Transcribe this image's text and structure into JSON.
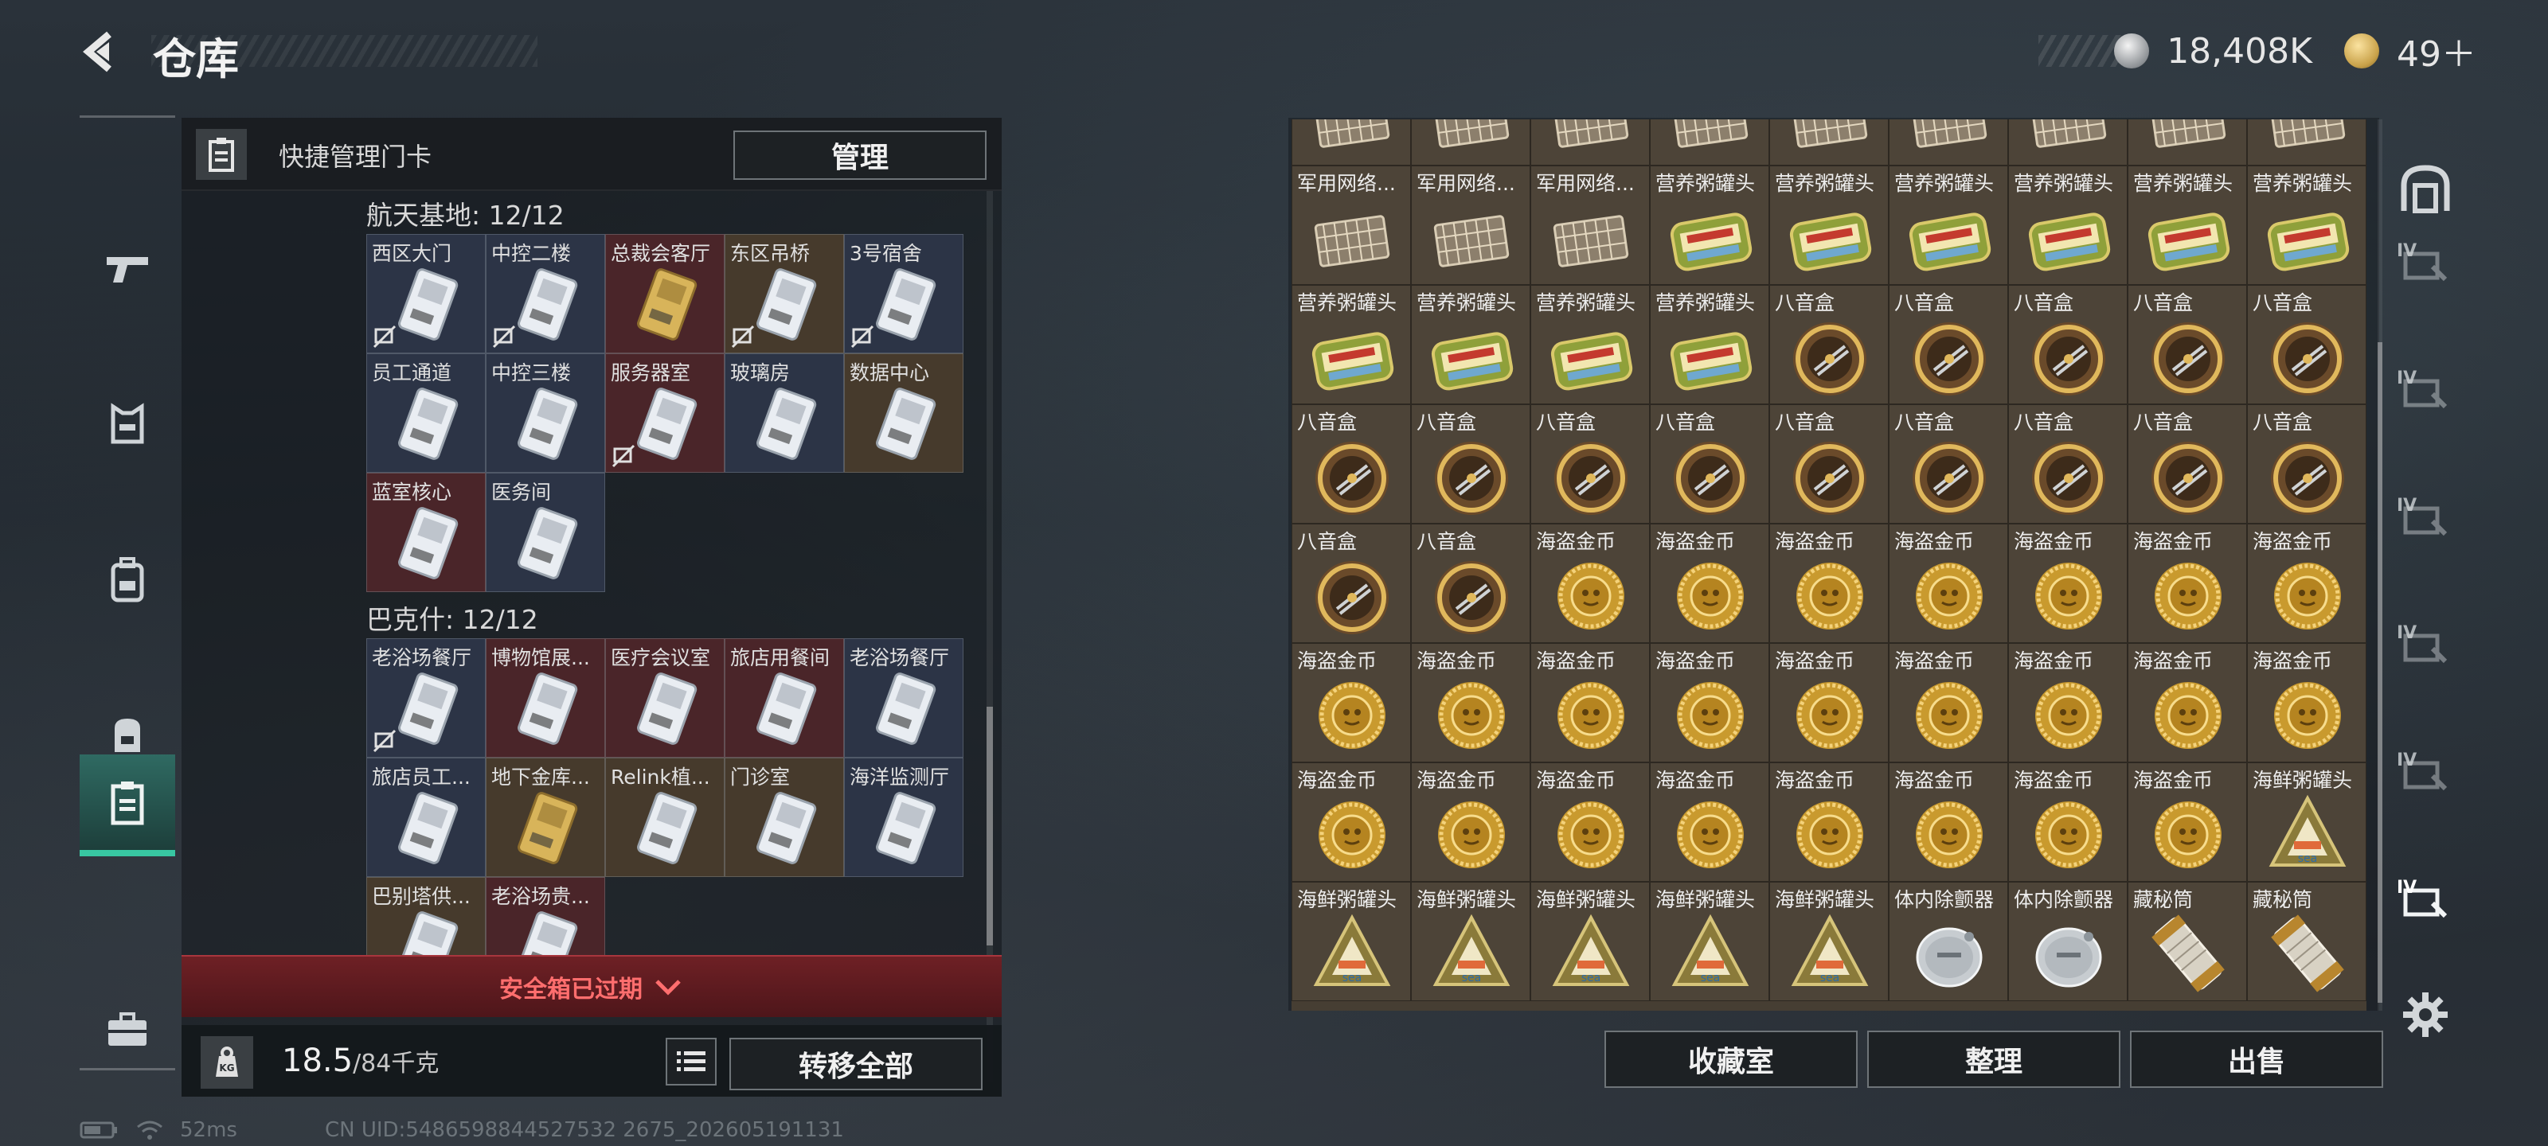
{
  "header": {
    "title": "仓库",
    "currencies": [
      {
        "icon": "silver-coin-icon",
        "value": "18,408K",
        "color": "#c8c8c8"
      },
      {
        "icon": "gold-token-icon",
        "value": "49＋",
        "color": "#c9a24a"
      }
    ]
  },
  "left_nav": {
    "items": [
      {
        "name": "weapon-icon"
      },
      {
        "name": "armor-icon"
      },
      {
        "name": "backpack-icon"
      },
      {
        "name": "bag-icon"
      },
      {
        "name": "keycard-holder-icon",
        "active": true
      },
      {
        "name": "briefcase-icon"
      }
    ]
  },
  "card_panel": {
    "header_title": "快捷管理门卡",
    "manage_label": "管理",
    "sections": [
      {
        "title": "航天基地: 12/12",
        "cards": [
          {
            "label": "西区大门",
            "color": "blue",
            "no_mark": true
          },
          {
            "label": "中控二楼",
            "color": "blue",
            "no_mark": true
          },
          {
            "label": "总裁会客厅",
            "color": "red",
            "gold": true
          },
          {
            "label": "东区吊桥",
            "color": "gold",
            "no_mark": true
          },
          {
            "label": "3号宿舍",
            "color": "blue",
            "no_mark": true
          },
          {
            "label": "员工通道",
            "color": "blue"
          },
          {
            "label": "中控三楼",
            "color": "blue"
          },
          {
            "label": "服务器室",
            "color": "red",
            "no_mark": true
          },
          {
            "label": "玻璃房",
            "color": "blue"
          },
          {
            "label": "数据中心",
            "color": "gold"
          },
          {
            "label": "蓝室核心",
            "color": "red"
          },
          {
            "label": "医务间",
            "color": "blue"
          }
        ]
      },
      {
        "title": "巴克什: 12/12",
        "cards": [
          {
            "label": "老浴场餐厅",
            "color": "blue",
            "no_mark": true
          },
          {
            "label": "博物馆展...",
            "color": "red"
          },
          {
            "label": "医疗会议室",
            "color": "red"
          },
          {
            "label": "旅店用餐间",
            "color": "red"
          },
          {
            "label": "老浴场餐厅",
            "color": "blue"
          },
          {
            "label": "旅店员工...",
            "color": "blue"
          },
          {
            "label": "地下金库...",
            "color": "gold",
            "gold": true
          },
          {
            "label": "Relink植...",
            "color": "gold"
          },
          {
            "label": "门诊室",
            "color": "gold"
          },
          {
            "label": "海洋监测厅",
            "color": "blue"
          },
          {
            "label": "巴别塔供...",
            "color": "gold"
          },
          {
            "label": "老浴场贵...",
            "color": "red"
          }
        ]
      }
    ],
    "expired_label": "安全箱已过期",
    "weight_current": "18.5",
    "weight_max": "/84千克",
    "transfer_label": "转移全部"
  },
  "inventory": {
    "rows": [
      [
        {
          "label": "",
          "kind": "net"
        },
        {
          "label": "",
          "kind": "net"
        },
        {
          "label": "",
          "kind": "net"
        },
        {
          "label": "",
          "kind": "net"
        },
        {
          "label": "",
          "kind": "net"
        },
        {
          "label": "",
          "kind": "net"
        },
        {
          "label": "",
          "kind": "net"
        },
        {
          "label": "",
          "kind": "net"
        },
        {
          "label": "",
          "kind": "net"
        }
      ],
      [
        {
          "label": "军用网络...",
          "kind": "net"
        },
        {
          "label": "军用网络...",
          "kind": "net"
        },
        {
          "label": "军用网络...",
          "kind": "net"
        },
        {
          "label": "营养粥罐头",
          "kind": "can"
        },
        {
          "label": "营养粥罐头",
          "kind": "can"
        },
        {
          "label": "营养粥罐头",
          "kind": "can"
        },
        {
          "label": "营养粥罐头",
          "kind": "can"
        },
        {
          "label": "营养粥罐头",
          "kind": "can"
        },
        {
          "label": "营养粥罐头",
          "kind": "can"
        }
      ],
      [
        {
          "label": "营养粥罐头",
          "kind": "can"
        },
        {
          "label": "营养粥罐头",
          "kind": "can"
        },
        {
          "label": "营养粥罐头",
          "kind": "can"
        },
        {
          "label": "营养粥罐头",
          "kind": "can"
        },
        {
          "label": "八音盒",
          "kind": "musicbox"
        },
        {
          "label": "八音盒",
          "kind": "musicbox"
        },
        {
          "label": "八音盒",
          "kind": "musicbox"
        },
        {
          "label": "八音盒",
          "kind": "musicbox"
        },
        {
          "label": "八音盒",
          "kind": "musicbox"
        }
      ],
      [
        {
          "label": "八音盒",
          "kind": "musicbox"
        },
        {
          "label": "八音盒",
          "kind": "musicbox"
        },
        {
          "label": "八音盒",
          "kind": "musicbox"
        },
        {
          "label": "八音盒",
          "kind": "musicbox"
        },
        {
          "label": "八音盒",
          "kind": "musicbox"
        },
        {
          "label": "八音盒",
          "kind": "musicbox"
        },
        {
          "label": "八音盒",
          "kind": "musicbox"
        },
        {
          "label": "八音盒",
          "kind": "musicbox"
        },
        {
          "label": "八音盒",
          "kind": "musicbox"
        }
      ],
      [
        {
          "label": "八音盒",
          "kind": "musicbox"
        },
        {
          "label": "八音盒",
          "kind": "musicbox"
        },
        {
          "label": "海盗金币",
          "kind": "coin"
        },
        {
          "label": "海盗金币",
          "kind": "coin"
        },
        {
          "label": "海盗金币",
          "kind": "coin"
        },
        {
          "label": "海盗金币",
          "kind": "coin"
        },
        {
          "label": "海盗金币",
          "kind": "coin"
        },
        {
          "label": "海盗金币",
          "kind": "coin"
        },
        {
          "label": "海盗金币",
          "kind": "coin"
        }
      ],
      [
        {
          "label": "海盗金币",
          "kind": "coin"
        },
        {
          "label": "海盗金币",
          "kind": "coin"
        },
        {
          "label": "海盗金币",
          "kind": "coin"
        },
        {
          "label": "海盗金币",
          "kind": "coin"
        },
        {
          "label": "海盗金币",
          "kind": "coin"
        },
        {
          "label": "海盗金币",
          "kind": "coin"
        },
        {
          "label": "海盗金币",
          "kind": "coin"
        },
        {
          "label": "海盗金币",
          "kind": "coin"
        },
        {
          "label": "海盗金币",
          "kind": "coin"
        }
      ],
      [
        {
          "label": "海盗金币",
          "kind": "coin"
        },
        {
          "label": "海盗金币",
          "kind": "coin"
        },
        {
          "label": "海盗金币",
          "kind": "coin"
        },
        {
          "label": "海盗金币",
          "kind": "coin"
        },
        {
          "label": "海盗金币",
          "kind": "coin"
        },
        {
          "label": "海盗金币",
          "kind": "coin"
        },
        {
          "label": "海盗金币",
          "kind": "coin"
        },
        {
          "label": "海盗金币",
          "kind": "coin"
        },
        {
          "label": "海鲜粥罐头",
          "kind": "tri"
        }
      ],
      [
        {
          "label": "海鲜粥罐头",
          "kind": "tri"
        },
        {
          "label": "海鲜粥罐头",
          "kind": "tri"
        },
        {
          "label": "海鲜粥罐头",
          "kind": "tri"
        },
        {
          "label": "海鲜粥罐头",
          "kind": "tri"
        },
        {
          "label": "海鲜粥罐头",
          "kind": "tri"
        },
        {
          "label": "体内除颤器",
          "kind": "defib"
        },
        {
          "label": "体内除颤器",
          "kind": "defib"
        },
        {
          "label": "藏秘筒",
          "kind": "cylinder"
        },
        {
          "label": "藏秘筒",
          "kind": "cylinder"
        }
      ]
    ],
    "buttons": {
      "collection": "收藏室",
      "sort": "整理",
      "sell": "出售"
    }
  },
  "right_rail": {
    "items": [
      {
        "name": "stash-icon",
        "label": ""
      },
      {
        "name": "container-lv-icon",
        "label": "IV"
      },
      {
        "name": "container-lv-icon",
        "label": "IV"
      },
      {
        "name": "container-lv-icon",
        "label": "IV"
      },
      {
        "name": "container-lv-icon",
        "label": "IV"
      },
      {
        "name": "container-lv-icon",
        "label": "IV"
      },
      {
        "name": "container-lv-icon",
        "label": "IV",
        "active": true
      },
      {
        "name": "settings-gear-icon",
        "label": ""
      }
    ]
  },
  "status": {
    "ping": "52ms",
    "uid": "CN UID:5486598844527532 2675_202605191131"
  },
  "colors": {
    "accent": "#38c7a2",
    "danger": "#ff6e6e",
    "card_blue": "#2c3446",
    "card_red": "#4a2529",
    "card_gold": "#463a2c"
  }
}
